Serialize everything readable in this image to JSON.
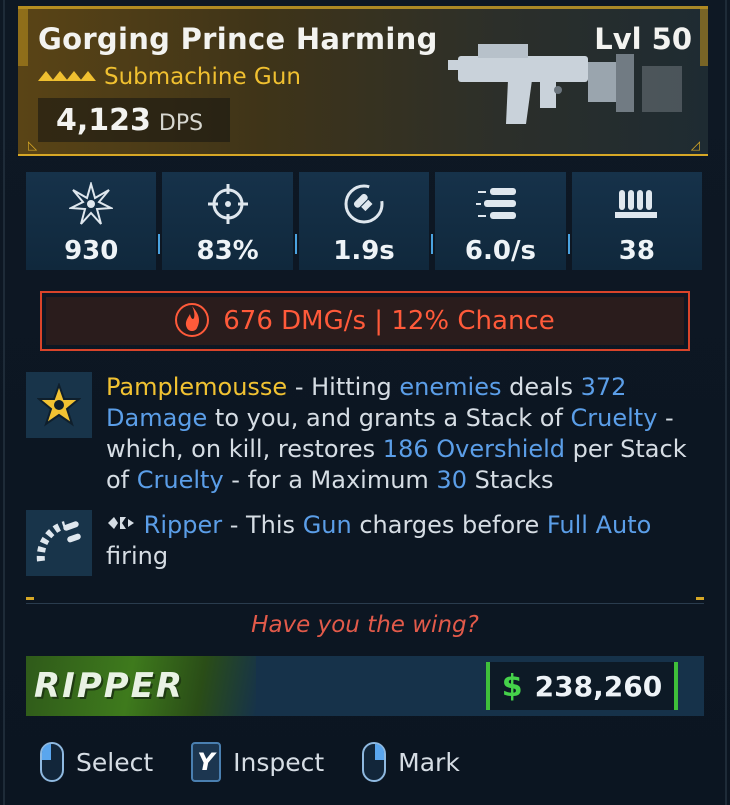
{
  "weapon": {
    "name": "Gorging Prince Harming",
    "level": "Lvl 50",
    "type": "Submachine Gun",
    "dps_value": "4,123",
    "dps_unit": "DPS",
    "rarity_color": "#f0c030"
  },
  "stats": [
    {
      "icon": "damage-burst-icon",
      "value": "930"
    },
    {
      "icon": "crosshair-accuracy-icon",
      "value": "83%"
    },
    {
      "icon": "reload-icon",
      "value": "1.9s"
    },
    {
      "icon": "fire-rate-bullets-icon",
      "value": "6.0/s"
    },
    {
      "icon": "magazine-icon",
      "value": "38"
    }
  ],
  "element": {
    "icon": "fire-element-icon",
    "text": "676 DMG/s | 12% Chance",
    "color": "#ff5a3a"
  },
  "perks": [
    {
      "icon": "star-badge-icon",
      "segments": [
        {
          "t": "Pamplemousse",
          "c": "gold"
        },
        {
          "t": " - Hitting ",
          "c": ""
        },
        {
          "t": "enemies",
          "c": "blue"
        },
        {
          "t": " deals ",
          "c": ""
        },
        {
          "t": "372",
          "c": "blue"
        },
        {
          "t": " ",
          "c": ""
        },
        {
          "t": "Damage",
          "c": "blue"
        },
        {
          "t": " to you, and grants a Stack of ",
          "c": ""
        },
        {
          "t": "Cruelty",
          "c": "blue"
        },
        {
          "t": " - which, on kill, restores ",
          "c": ""
        },
        {
          "t": "186",
          "c": "blue"
        },
        {
          "t": " ",
          "c": ""
        },
        {
          "t": "Overshield",
          "c": "blue"
        },
        {
          "t": " per Stack of ",
          "c": ""
        },
        {
          "t": "Cruelty",
          "c": "blue"
        },
        {
          "t": " - for a Maximum ",
          "c": ""
        },
        {
          "t": "30",
          "c": "blue"
        },
        {
          "t": " Stacks",
          "c": ""
        }
      ]
    },
    {
      "icon": "ammo-belt-icon",
      "segments": [
        {
          "t": "Ripper",
          "c": "blue"
        },
        {
          "t": " - This ",
          "c": ""
        },
        {
          "t": "Gun",
          "c": "blue"
        },
        {
          "t": " charges before ",
          "c": ""
        },
        {
          "t": "Full Auto",
          "c": "blue"
        },
        {
          "t": " firing",
          "c": ""
        }
      ]
    }
  ],
  "flavor_text": "Have you the wing?",
  "manufacturer": "RIPPER",
  "price": {
    "symbol": "$",
    "value": "238,260"
  },
  "controls": [
    {
      "key": "left-mouse-icon",
      "label": "Select"
    },
    {
      "key": "Y",
      "label": "Inspect"
    },
    {
      "key": "right-mouse-icon",
      "label": "Mark"
    }
  ]
}
